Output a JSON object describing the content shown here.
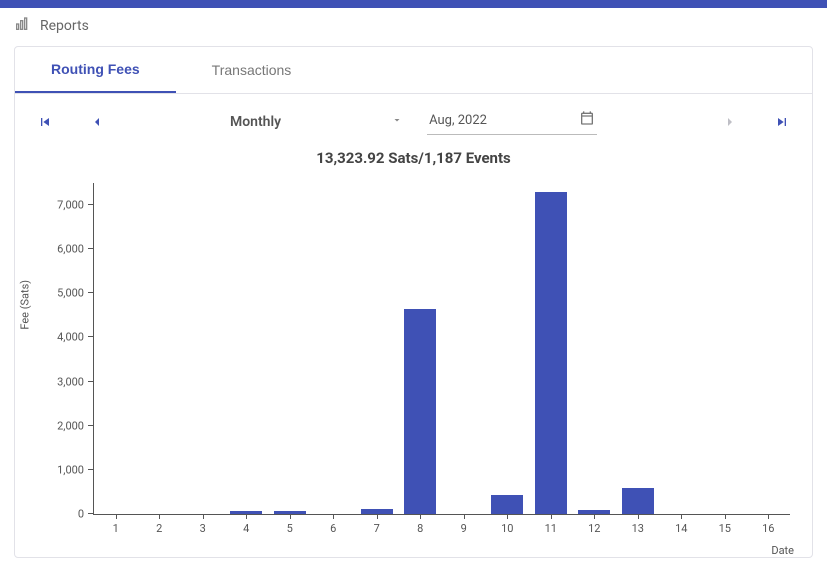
{
  "header": {
    "title": "Reports"
  },
  "tabs": [
    {
      "label": "Routing Fees",
      "active": true
    },
    {
      "label": "Transactions",
      "active": false
    }
  ],
  "controls": {
    "period_label": "Monthly",
    "date_value": "Aug, 2022"
  },
  "summary": "13,323.92 Sats/1,187 Events",
  "chart_data": {
    "type": "bar",
    "title": "13,323.92 Sats/1,187 Events",
    "xlabel": "Date",
    "ylabel": "Fee (Sats)",
    "ylim": [
      0,
      7500
    ],
    "yticks": [
      0,
      1000,
      2000,
      3000,
      4000,
      5000,
      6000,
      7000
    ],
    "ytick_labels": [
      "0",
      "1,000",
      "2,000",
      "3,000",
      "4,000",
      "5,000",
      "6,000",
      "7,000"
    ],
    "categories": [
      "1",
      "2",
      "3",
      "4",
      "5",
      "6",
      "7",
      "8",
      "9",
      "10",
      "11",
      "12",
      "13",
      "14",
      "15",
      "16"
    ],
    "values": [
      0,
      0,
      0,
      60,
      60,
      0,
      120,
      4650,
      0,
      430,
      7300,
      100,
      600,
      0,
      0,
      0
    ]
  }
}
